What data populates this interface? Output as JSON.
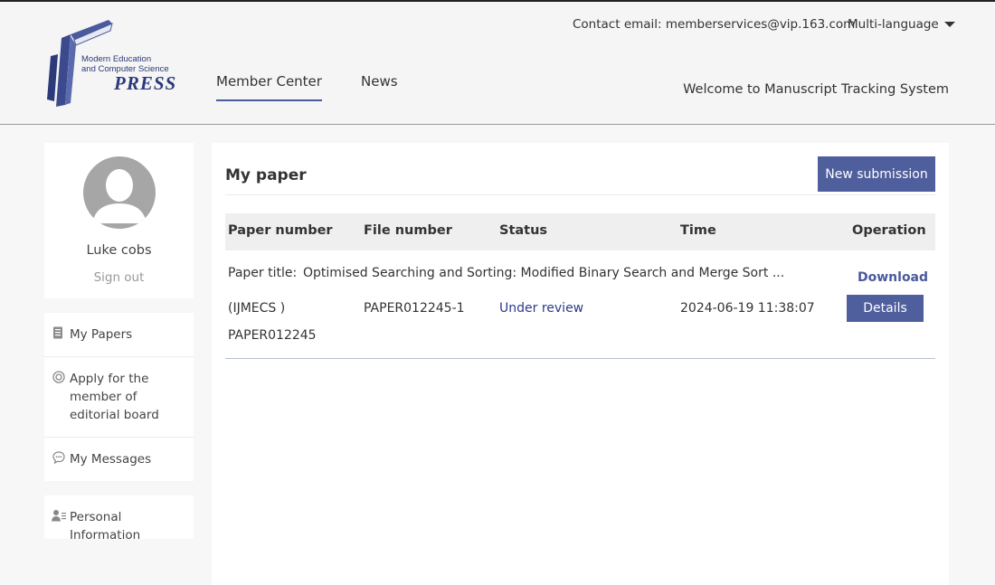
{
  "header": {
    "logo": {
      "line1": "Modern Education",
      "line2": "and Computer Science",
      "press": "PRESS",
      "icon": "book-logo-icon"
    },
    "contact_label": "Contact email:",
    "contact_email": "memberservices@vip.163.com",
    "language_label": "Multi-language",
    "nav": [
      {
        "label": "Member Center",
        "active": true
      },
      {
        "label": "News",
        "active": false
      }
    ],
    "welcome": "Welcome to Manuscript Tracking System"
  },
  "sidebar": {
    "profile": {
      "avatar_icon": "user-avatar-icon",
      "username": "Luke cobs",
      "signout": "Sign out"
    },
    "menu": [
      {
        "label": "My Papers",
        "icon": "document-icon"
      },
      {
        "label": "Apply for the member of editorial board",
        "icon": "badge-icon"
      },
      {
        "label": "My Messages",
        "icon": "chat-bubble-icon"
      }
    ],
    "personal": {
      "label": "Personal Information",
      "icon": "user-card-icon"
    }
  },
  "main": {
    "title": "My paper",
    "new_submission": "New submission",
    "columns": [
      "Paper number",
      "File number",
      "Status",
      "Time",
      "Operation"
    ],
    "rows": [
      {
        "paper_title_label": "Paper title:",
        "paper_title": "Optimised Searching and Sorting: Modified Binary Search and Merge Sort ...",
        "download": "Download",
        "journal": "(IJMECS )",
        "paper_number": "PAPER012245",
        "file_number": "PAPER012245-1",
        "status": "Under review",
        "time": "2024-06-19 11:38:07",
        "details": "Details"
      }
    ]
  },
  "colors": {
    "accent": "#4f5e9c",
    "link": "#2c3a8a",
    "background": "#f7f7f7"
  }
}
